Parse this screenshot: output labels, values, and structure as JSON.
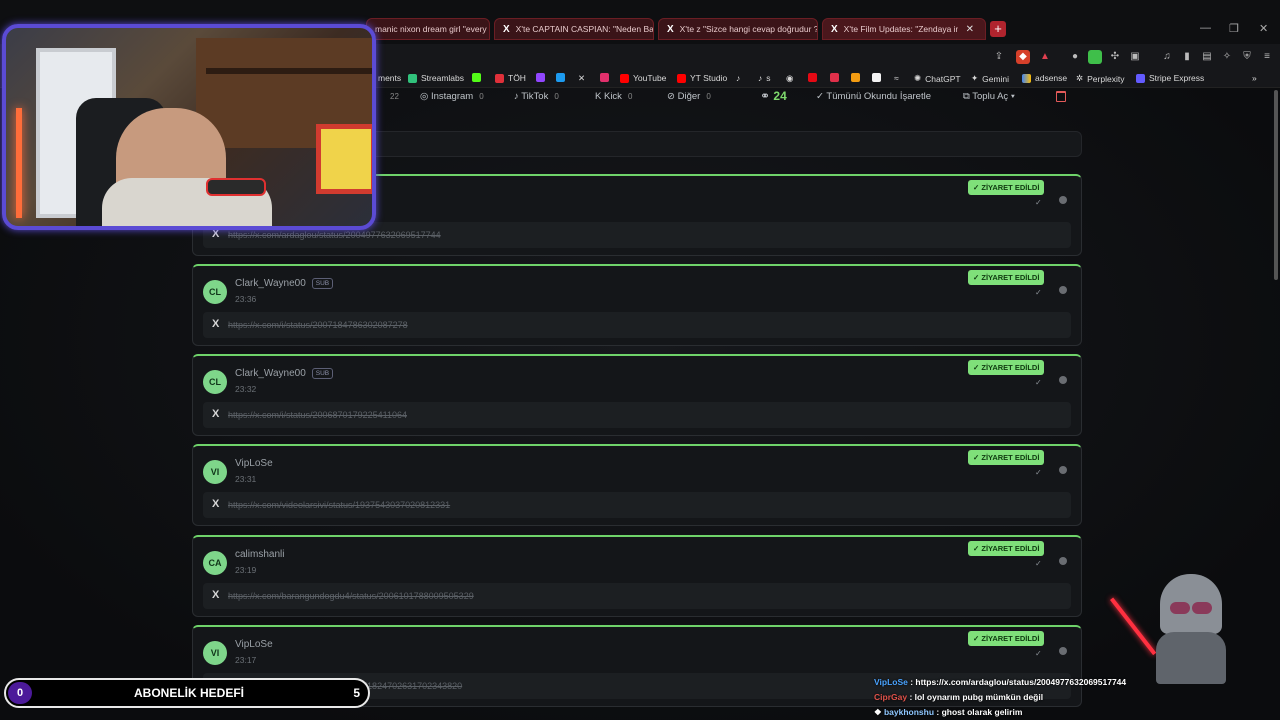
{
  "browser": {
    "tabs": [
      {
        "label": "manic nixon dream girl \"every s"
      },
      {
        "label": "X'te CAPTAIN CASPIAN: \"Neden Bay"
      },
      {
        "label": "X'te z \"Sizce hangi cevap doğrudur ?"
      },
      {
        "label": "X'te Film Updates: \"Zendaya in 2"
      }
    ],
    "new_tab": "+",
    "bookmarks": [
      {
        "label": "ments"
      },
      {
        "label": "Streamlabs"
      },
      {
        "label": "TÖH"
      },
      {
        "label": "YouTube"
      },
      {
        "label": "YT Studio"
      },
      {
        "label": "s"
      },
      {
        "label": "ChatGPT"
      },
      {
        "label": "Gemini"
      },
      {
        "label": "adsense"
      },
      {
        "label": "Perplexity"
      },
      {
        "label": "Stripe Express"
      }
    ]
  },
  "filters": {
    "items": [
      {
        "label": "",
        "count": "22"
      },
      {
        "label": "Instagram",
        "count": "0"
      },
      {
        "label": "TikTok",
        "count": "0"
      },
      {
        "label": "Kick",
        "count": "0"
      },
      {
        "label": "Diğer",
        "count": "0"
      }
    ],
    "link_count": "24",
    "mark_all_read": "✓  Tümünü Okundu İşaretle",
    "bulk_open": "Toplu Aç  ▾"
  },
  "cards": [
    {
      "initials": "",
      "user": "",
      "sub": "",
      "time": "",
      "badge": "✓ ZİYARET EDİLDİ",
      "url": "https://x.com/ardaglou/status/2004977632069517744"
    },
    {
      "initials": "CL",
      "user": "Clark_Wayne00",
      "sub": "SUB",
      "time": "23:36",
      "badge": "✓ ZİYARET EDİLDİ",
      "url": "https://x.com/i/status/2007184786302087278"
    },
    {
      "initials": "CL",
      "user": "Clark_Wayne00",
      "sub": "SUB",
      "time": "23:32",
      "badge": "✓ ZİYARET EDİLDİ",
      "url": "https://x.com/i/status/2006870179225411064"
    },
    {
      "initials": "VI",
      "user": "VipLoSe",
      "sub": "",
      "time": "23:31",
      "badge": "✓ ZİYARET EDİLDİ",
      "url": "https://x.com/videolarsivi/status/1937543037020812331"
    },
    {
      "initials": "CA",
      "user": "calimshanli",
      "sub": "",
      "time": "23:19",
      "badge": "✓ ZİYARET EDİLDİ",
      "url": "https://x.com/barangundogdu4/status/2006101788009505329"
    },
    {
      "initials": "VI",
      "user": "VipLoSe",
      "sub": "",
      "time": "23:17",
      "badge": "✓ ZİYARET EDİLDİ",
      "url": "https://x.com/alemdar_arsiv/status/1824702631702343820"
    }
  ],
  "overlay": {
    "goal_current": "0",
    "goal_label": "ABONELİK HEDEFİ",
    "goal_target": "5",
    "chat": [
      {
        "name": "VipLoSe",
        "text": " : https://x.com/ardaglou/status/2004977632069517744"
      },
      {
        "name": "CiprGay",
        "text": " : lol oynarım pubg mümkün değil"
      },
      {
        "name": "baykhonshu",
        "text": " : ghost olarak gelirim"
      }
    ]
  }
}
